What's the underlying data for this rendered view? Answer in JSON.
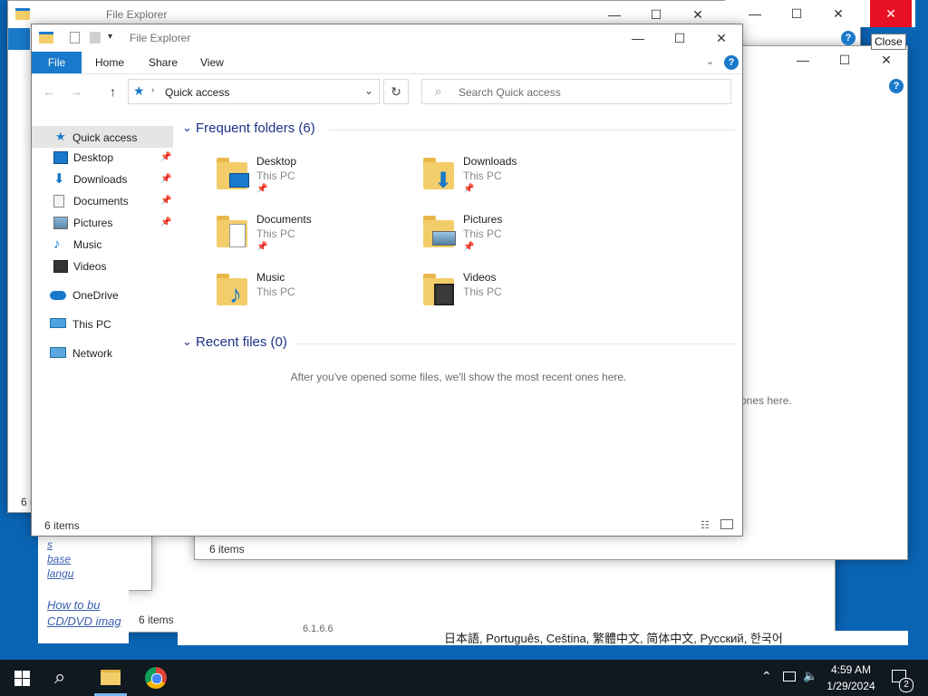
{
  "background_windows": {
    "title": "File Explorer",
    "items_count": "6 items",
    "recent_text_fragment": "ones here.",
    "tooltip": "Close",
    "web_links": [
      "How to bu",
      "CD/DVD imag",
      "s",
      "base",
      "langu"
    ],
    "languages_line": "日本語, Português, Ceština, 繁體中文, 简体中文, Русский, 한국어",
    "version_fragment": "6.1.6.6"
  },
  "window": {
    "title": "File Explorer",
    "tabs": [
      "File",
      "Home",
      "Share",
      "View"
    ],
    "address": "Quick access",
    "search_placeholder": "Search Quick access",
    "status": "6 items"
  },
  "sidebar": {
    "quick_access": "Quick access",
    "pinned": [
      {
        "label": "Desktop",
        "icon": "desktop-icon"
      },
      {
        "label": "Downloads",
        "icon": "downloads-icon"
      },
      {
        "label": "Documents",
        "icon": "documents-icon"
      },
      {
        "label": "Pictures",
        "icon": "pictures-icon"
      }
    ],
    "unpinned": [
      {
        "label": "Music",
        "icon": "music-icon"
      },
      {
        "label": "Videos",
        "icon": "videos-icon"
      }
    ],
    "onedrive": "OneDrive",
    "this_pc": "This PC",
    "network": "Network"
  },
  "main": {
    "frequent_header": "Frequent folders (6)",
    "folders": [
      {
        "name": "Desktop",
        "location": "This PC",
        "pinned": true
      },
      {
        "name": "Downloads",
        "location": "This PC",
        "pinned": true
      },
      {
        "name": "Documents",
        "location": "This PC",
        "pinned": true
      },
      {
        "name": "Pictures",
        "location": "This PC",
        "pinned": true
      },
      {
        "name": "Music",
        "location": "This PC",
        "pinned": false
      },
      {
        "name": "Videos",
        "location": "This PC",
        "pinned": false
      }
    ],
    "recent_header": "Recent files (0)",
    "recent_empty": "After you've opened some files, we'll show the most recent ones here."
  },
  "taskbar": {
    "time": "4:59 AM",
    "date": "1/29/2024",
    "notification_count": "2"
  },
  "colors": {
    "accent": "#1979ca",
    "desktop": "#0a64b4",
    "close_red": "#e81123",
    "folder": "#f3cd6a"
  }
}
